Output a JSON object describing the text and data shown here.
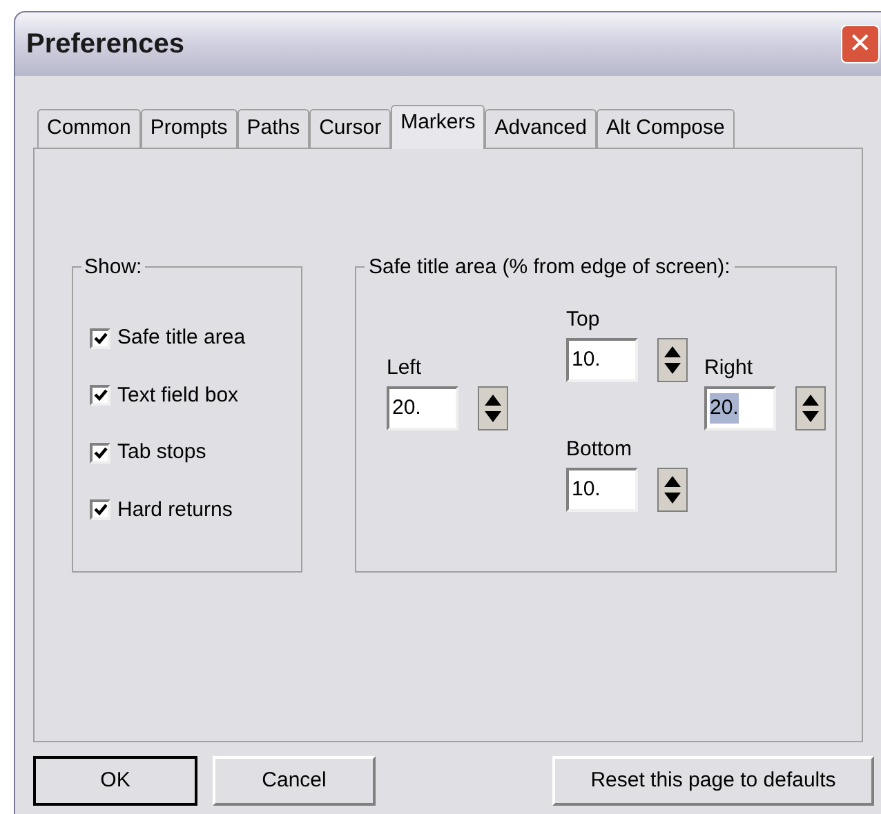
{
  "window": {
    "title": "Preferences",
    "close": "✕"
  },
  "tabs": [
    {
      "label": "Common",
      "selected": false
    },
    {
      "label": "Prompts",
      "selected": false
    },
    {
      "label": "Paths",
      "selected": false
    },
    {
      "label": "Cursor",
      "selected": false
    },
    {
      "label": "Markers",
      "selected": true
    },
    {
      "label": "Advanced",
      "selected": false
    },
    {
      "label": "Alt Compose",
      "selected": false
    }
  ],
  "show_group": {
    "title": "Show:",
    "items": [
      {
        "label": "Safe title area",
        "checked": true
      },
      {
        "label": "Text field box",
        "checked": true
      },
      {
        "label": "Tab stops",
        "checked": true
      },
      {
        "label": "Hard returns",
        "checked": true
      }
    ]
  },
  "safe_area_group": {
    "title": "Safe title area (% from edge of screen):",
    "fields": [
      {
        "label": "Top",
        "value": "10.",
        "selected": false
      },
      {
        "label": "Left",
        "value": "20.",
        "selected": false
      },
      {
        "label": "Right",
        "value": "20.",
        "selected": true
      },
      {
        "label": "Bottom",
        "value": "10.",
        "selected": false
      }
    ]
  },
  "buttons": [
    {
      "label": "OK",
      "default": true
    },
    {
      "label": "Cancel",
      "default": false
    },
    {
      "label": "Reset this page to defaults",
      "default": false
    }
  ]
}
